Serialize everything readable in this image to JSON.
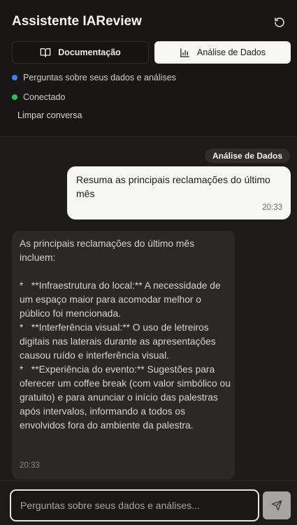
{
  "header": {
    "title": "Assistente IAReview",
    "reset_icon": "refresh-icon",
    "tabs": [
      {
        "label": "Documentação",
        "icon": "book-icon",
        "active": false
      },
      {
        "label": "Análise de Dados",
        "icon": "bar-chart-icon",
        "active": true
      }
    ],
    "status": [
      {
        "text": "Perguntas sobre seus dados e análises",
        "color": "#3b82f6"
      },
      {
        "text": "Conectado",
        "color": "#22c55e"
      }
    ],
    "clear_label": "Limpar conversa"
  },
  "chat": {
    "mode_badge": "Análise de Dados",
    "messages": [
      {
        "role": "user",
        "text": "Resuma as principais reclamações do último mês",
        "time": "20:33"
      },
      {
        "role": "assistant",
        "text": "As principais reclamações do último mês incluem:\n\n*   **Infraestrutura do local:** A necessidade de um espaço maior para acomodar melhor o público foi mencionada.\n*   **Interferência visual:** O uso de letreiros digitais nas laterais durante as apresentações causou ruído e interferência visual.\n*   **Experiência do evento:** Sugestões para oferecer um coffee break (com valor simbólico ou gratuito) e para anunciar o início das palestras após intervalos, informando a todos os envolvidos fora do ambiente da palestra.",
        "time": "20:33"
      }
    ]
  },
  "composer": {
    "placeholder": "Perguntas sobre seus dados e análises...",
    "value": "",
    "send_icon": "send-icon"
  },
  "colors": {
    "background": "#1c1b19",
    "user_bubble": "#f6f6f4",
    "assistant_bubble": "#2b2826",
    "status_blue": "#3b82f6",
    "status_green": "#22c55e"
  }
}
